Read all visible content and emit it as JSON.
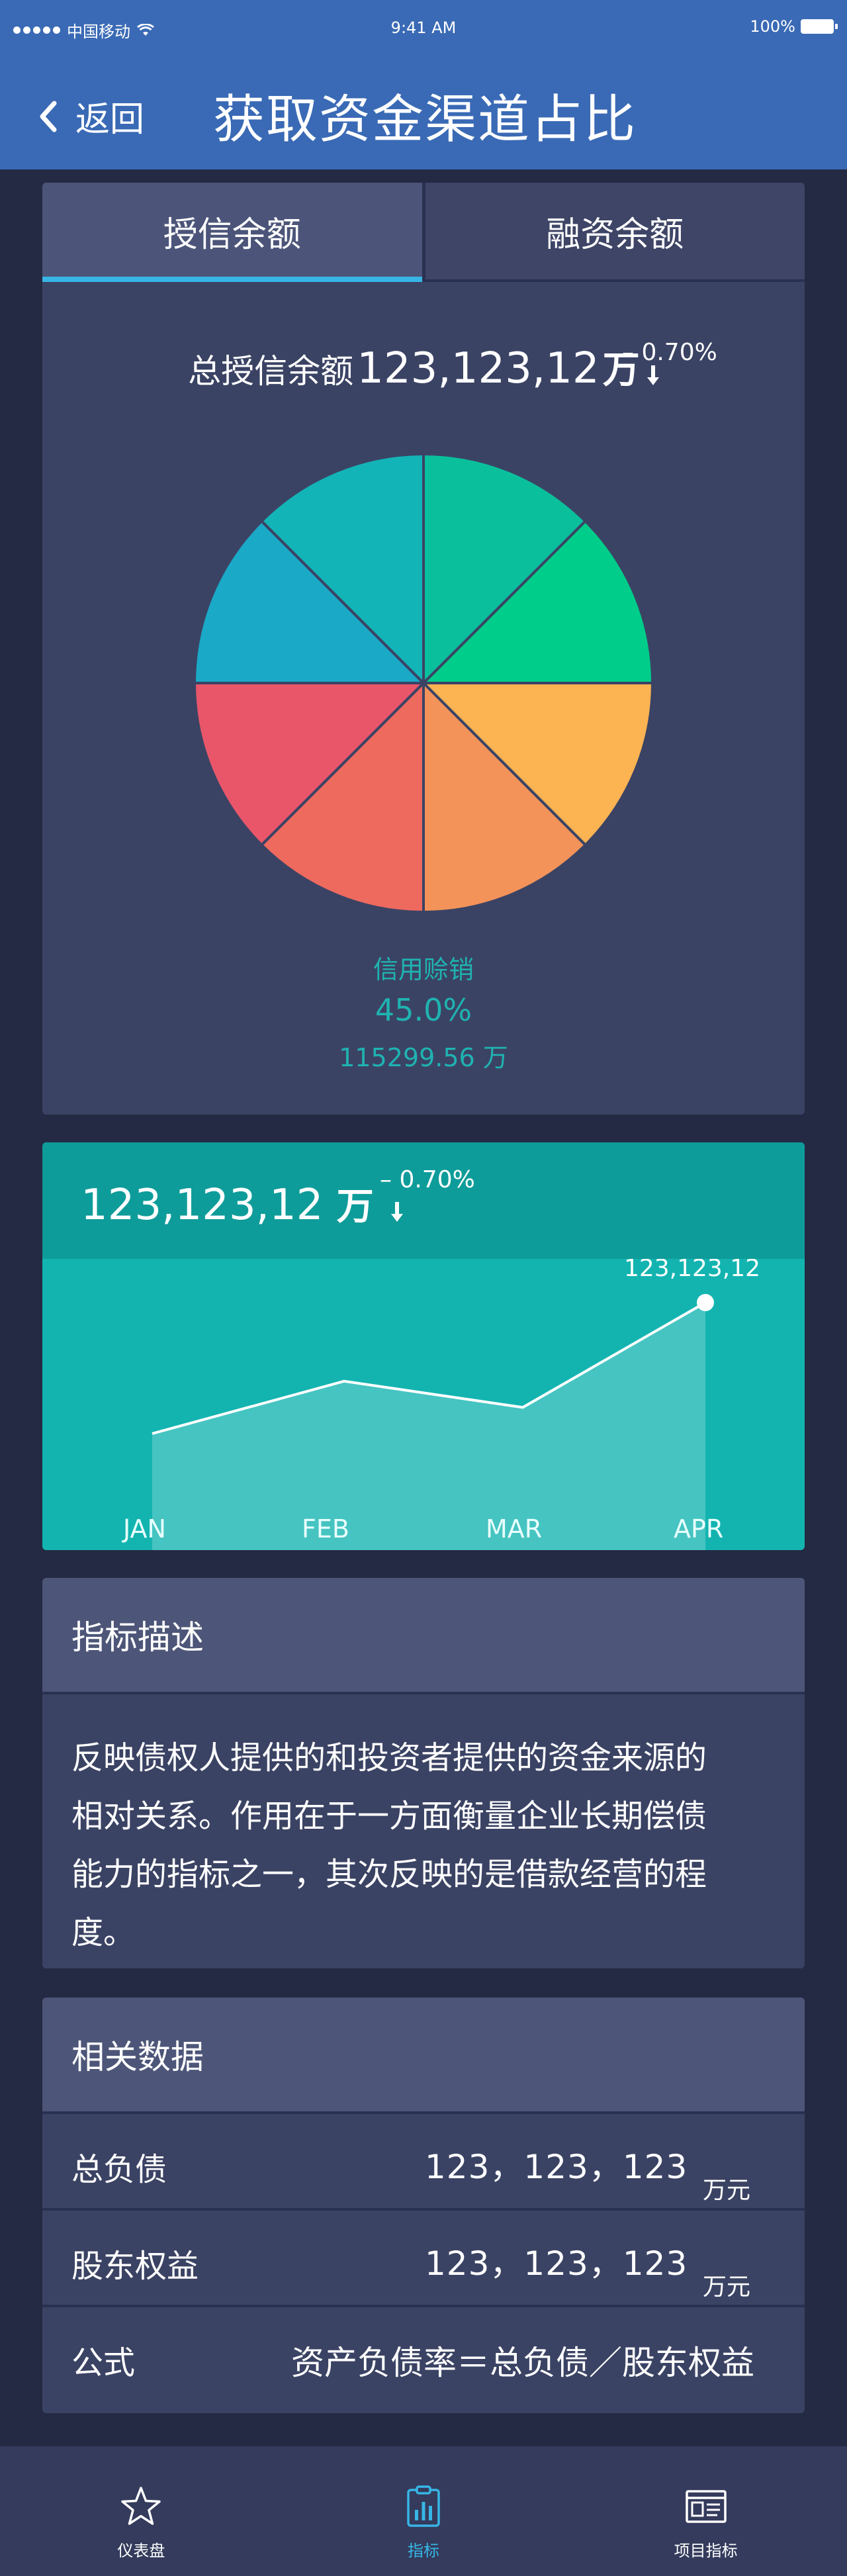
{
  "status_bar": {
    "carrier": "中国移动",
    "time": "9:41 AM",
    "battery": "100%"
  },
  "header": {
    "back_label": "返回",
    "title": "获取资金渠道占比"
  },
  "tabs": [
    {
      "label": "授信余额",
      "active": true
    },
    {
      "label": "融资余额",
      "active": false
    }
  ],
  "summary": {
    "label": "总授信余额",
    "value": "123,123,12",
    "unit": "万",
    "change": "– 0.70%"
  },
  "pie": {
    "slices": [
      {
        "value": 12.5,
        "color": "#0abf9c"
      },
      {
        "value": 12.5,
        "color": "#00cd8a"
      },
      {
        "value": 12.5,
        "color": "#fcb352"
      },
      {
        "value": 12.5,
        "color": "#f3935a"
      },
      {
        "value": 12.5,
        "color": "#ee6a5e"
      },
      {
        "value": 12.5,
        "color": "#e9566a"
      },
      {
        "value": 12.5,
        "color": "#1aa9c7"
      },
      {
        "value": 12.5,
        "color": "#13b4b7"
      }
    ],
    "selected_name": "信用赊销",
    "selected_percent": "45.0%",
    "selected_amount": "115299.56 万"
  },
  "trend": {
    "value": "123,123,12",
    "unit": "万",
    "change": "– 0.70%",
    "point_label": "123,123,12"
  },
  "chart_data": {
    "type": "area",
    "categories": [
      "JAN",
      "FEB",
      "MAR",
      "APR"
    ],
    "series": [
      {
        "values": [
          10,
          22,
          16,
          40
        ]
      }
    ],
    "ylim": [
      0,
      50
    ],
    "annotations": [
      {
        "x": "APR",
        "text": "123,123,12"
      }
    ],
    "grid": false
  },
  "description": {
    "title": "指标描述",
    "lines": [
      "反映债权人提供的和投资者提供的资金来源的",
      "相对关系。作用在于一方面衡量企业长期偿债",
      "能力的指标之一，其次反映的是借款经营的程",
      "度。"
    ]
  },
  "related": {
    "title": "相关数据",
    "rows": [
      {
        "key": "总负债",
        "value": "123，123，123",
        "unit": "万元"
      },
      {
        "key": "股东权益",
        "value": "123，123，123",
        "unit": "万元"
      }
    ],
    "formula_key": "公式",
    "formula": "资产负债率＝总负债／股东权益"
  },
  "navbar": [
    {
      "label": "仪表盘",
      "icon": "star-icon"
    },
    {
      "label": "指标",
      "icon": "clipboard-chart-icon"
    },
    {
      "label": "项目指标",
      "icon": "browser-window-icon"
    }
  ],
  "colors": {
    "header": "#3a6ab5",
    "background": "#242a43",
    "card": "#3b4364",
    "accent": "#37b6e6",
    "teal": "#13b4b0"
  }
}
